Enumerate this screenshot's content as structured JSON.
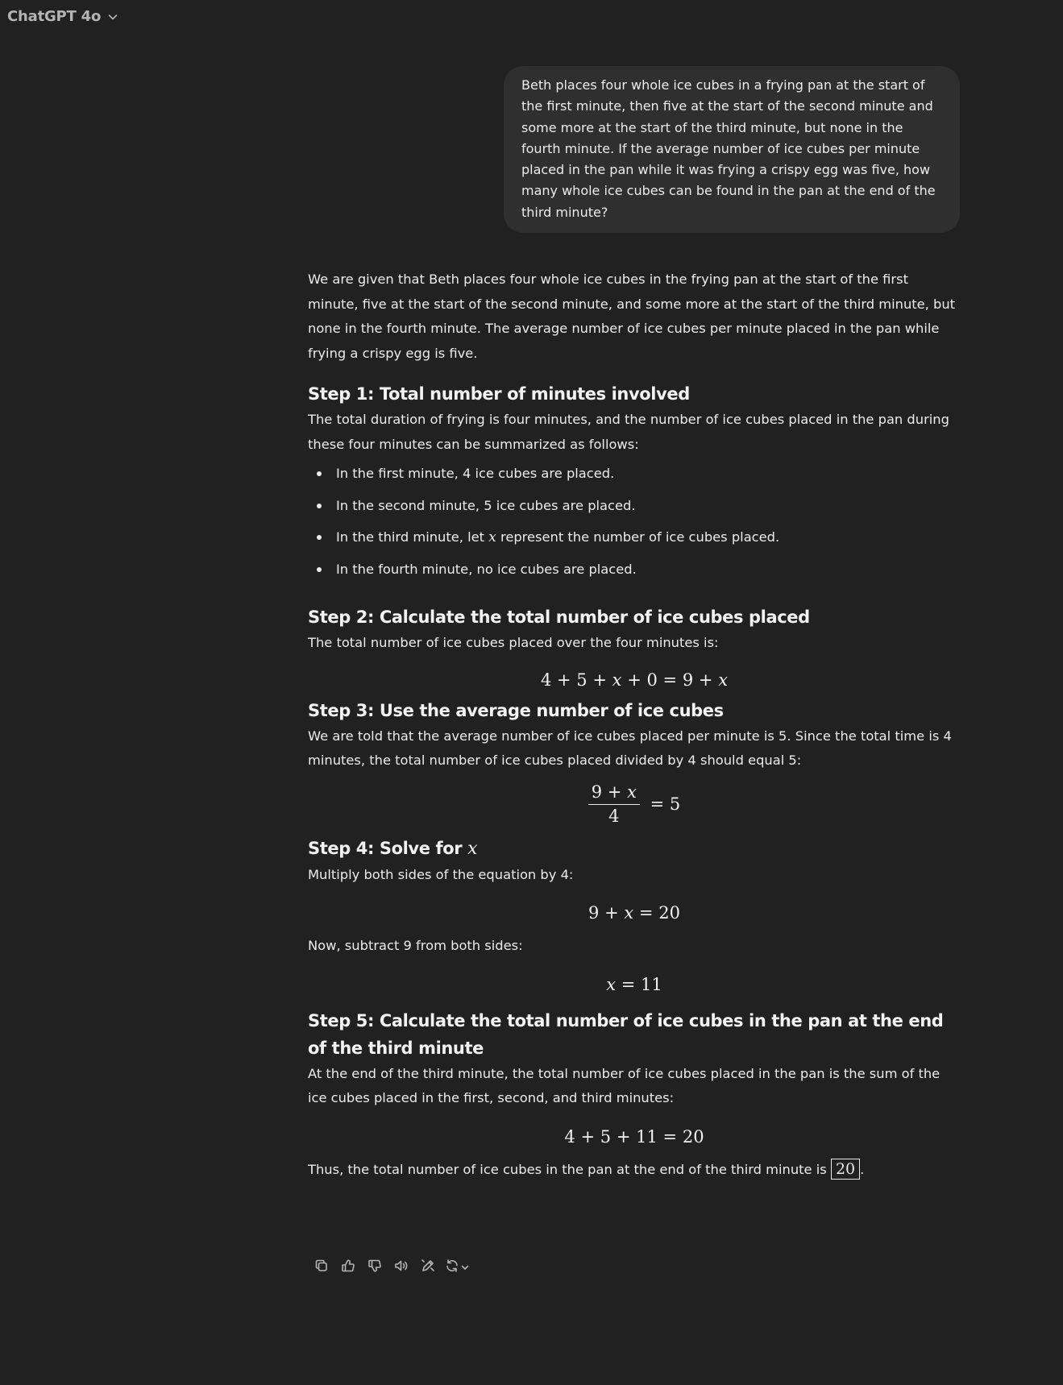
{
  "header": {
    "model_name": "ChatGPT 4o",
    "icons": {
      "dropdown": "chevron-down-icon"
    }
  },
  "user_message": {
    "text": "Beth places four whole ice cubes in a frying pan at the start of the first minute, then five at the start of the second minute and some more at the start of the third minute, but none in the fourth minute. If the average number of ice cubes per minute placed in the pan while it was frying a crispy egg was five, how many whole ice cubes can be found in the pan at the end of the third minute?"
  },
  "assistant": {
    "intro": "We are given that Beth places four whole ice cubes in the frying pan at the start of the first minute, five at the start of the second minute, and some more at the start of the third minute, but none in the fourth minute. The average number of ice cubes per minute placed in the pan while frying a crispy egg is five.",
    "step1": {
      "heading": "Step 1: Total number of minutes involved",
      "text": "The total duration of frying is four minutes, and the number of ice cubes placed in the pan during these four minutes can be summarized as follows:",
      "bullets": [
        "In the first minute, 4 ice cubes are placed.",
        "In the second minute, 5 ice cubes are placed.",
        {
          "before": "In the third minute, let ",
          "var": "x",
          "after": " represent the number of ice cubes placed."
        },
        "In the fourth minute, no ice cubes are placed."
      ]
    },
    "step2": {
      "heading": "Step 2: Calculate the total number of ice cubes placed",
      "text": "The total number of ice cubes placed over the four minutes is:",
      "equation": "4 + 5 + x + 0 = 9 + x"
    },
    "step3": {
      "heading": "Step 3: Use the average number of ice cubes",
      "text": "We are told that the average number of ice cubes placed per minute is 5. Since the total time is 4 minutes, the total number of ice cubes placed divided by 4 should equal 5:",
      "equation": {
        "numerator": "9 + x",
        "denominator": "4",
        "rhs": "= 5"
      }
    },
    "step4": {
      "heading_prefix": "Step 4: Solve for ",
      "heading_var": "x",
      "text1": "Multiply both sides of the equation by 4:",
      "equation1": "9 + x = 20",
      "text2": "Now, subtract 9 from both sides:",
      "equation2": "x = 11"
    },
    "step5": {
      "heading": "Step 5: Calculate the total number of ice cubes in the pan at the end of the third minute",
      "text": "At the end of the third minute, the total number of ice cubes placed in the pan is the sum of the ice cubes placed in the first, second, and third minutes:",
      "equation": "4 + 5 + 11 = 20"
    },
    "conclusion": {
      "text": "Thus, the total number of ice cubes in the pan at the end of the third minute is ",
      "answer": "20",
      "end": "."
    }
  },
  "actions": {
    "icons": [
      "copy-icon",
      "thumbs-up-icon",
      "thumbs-down-icon",
      "read-aloud-icon",
      "edit-in-canvas-icon",
      "regenerate-icon",
      "chevron-down-icon"
    ]
  }
}
